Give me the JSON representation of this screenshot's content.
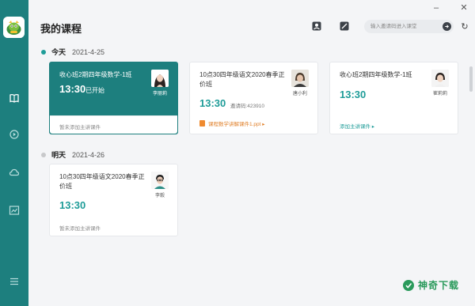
{
  "window": {
    "minimize_glyph": "–",
    "close_glyph": "✕"
  },
  "sidebar": {
    "logo": "app-logo",
    "items": [
      {
        "name": "course-book",
        "icon": "book-icon"
      },
      {
        "name": "playback",
        "icon": "replay-icon"
      },
      {
        "name": "cloud",
        "icon": "cloud-icon"
      },
      {
        "name": "analytics",
        "icon": "chart-icon"
      },
      {
        "name": "menu",
        "icon": "menu-icon"
      }
    ]
  },
  "header": {
    "title": "我的课程",
    "search_placeholder": "输入邀请码进入课堂",
    "refresh_glyph": "↻"
  },
  "colors": {
    "brand": "#1d7f7e",
    "time_accent": "#1e9c98",
    "courseware_orange": "#e0802a"
  },
  "days": [
    {
      "label": "今天",
      "date": "2021-4-25",
      "dot_color": "#1e9c98",
      "cards": [
        {
          "title": "收心班2期四年级数学-1班",
          "time": "13:30",
          "status": "已开始",
          "teacher": "李丽莉",
          "footer": "暂未添加主讲课件",
          "active": true
        },
        {
          "title": "10点30四年级语文2020春季正价班",
          "time": "13:30",
          "code": "邀请码:423910",
          "teacher": "唐小利",
          "courseware": "课程数学讲解课件1.ppt ▸",
          "active": false
        },
        {
          "title": "收心班2期四年级数学-1班",
          "time": "13:30",
          "teacher": "崔莉莉",
          "footer_link": "添加主讲课件 ▸",
          "active": false
        }
      ]
    },
    {
      "label": "明天",
      "date": "2021-4-26",
      "dot_color": "#c8c9cb",
      "cards": [
        {
          "title": "10点30四年级语文2020春季正价班",
          "time": "13:30",
          "teacher": "李毅",
          "footer": "暂未添加主讲课件",
          "active": false
        }
      ]
    }
  ],
  "watermark": {
    "text": "神奇下载"
  }
}
